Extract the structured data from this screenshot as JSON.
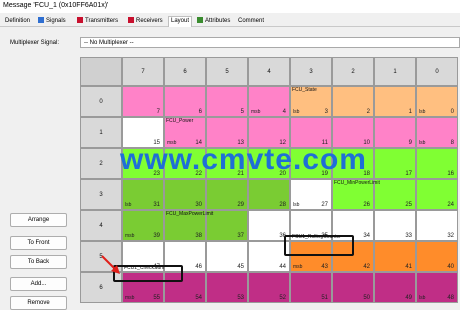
{
  "window": {
    "title": "Message 'FCU_1 (0x10FF6A01x)'"
  },
  "tabs": [
    {
      "label": "Definition",
      "icon": "none"
    },
    {
      "label": "Signals",
      "icon": "signal-icon",
      "color": "#2f6fd1"
    },
    {
      "label": "Transmitters",
      "icon": "transmitter-icon",
      "color": "#c8102e"
    },
    {
      "label": "Receivers",
      "icon": "receiver-icon",
      "color": "#c8102e"
    },
    {
      "label": "Layout",
      "icon": "none",
      "active": true
    },
    {
      "label": "Attributes",
      "icon": "attributes-icon",
      "color": "#3a8c2f"
    },
    {
      "label": "Comment",
      "icon": "none"
    }
  ],
  "mux": {
    "label": "Multiplexer Signal:",
    "value": "-- No Multiplexer --"
  },
  "bit_headers": [
    "7",
    "6",
    "5",
    "4",
    "3",
    "2",
    "1",
    "0"
  ],
  "byte_headers": [
    "0",
    "1",
    "2",
    "3",
    "4",
    "5",
    "6"
  ],
  "buttons": {
    "arrange": "Arrange",
    "to_front": "To Front",
    "to_back": "To Back",
    "add": "Add...",
    "remove": "Remove"
  },
  "colors": {
    "pink": "#ff82c8",
    "orange_light": "#ffbf80",
    "green": "#80ff33",
    "green_dark": "#7acc33",
    "orange": "#ff8c2a",
    "magenta": "#c02e86"
  },
  "signals": {
    "state": "FCU_State",
    "power": "FCU_Power",
    "min_power": "FCU_MinPowerLimit",
    "max_power": "FCU_MaxPowerLimit",
    "rolling": "FCU1_RollingCounter",
    "checksum": "FCU1_CheckSum"
  },
  "tags": {
    "lsb": "lsb",
    "msb": "msb"
  },
  "watermark": "www.cmvte.com",
  "cells": [
    [
      "7",
      "6",
      "5",
      "4",
      "3",
      "2",
      "1",
      "0"
    ],
    [
      "15",
      "14",
      "13",
      "12",
      "11",
      "10",
      "9",
      "8"
    ],
    [
      "23",
      "22",
      "21",
      "20",
      "19",
      "18",
      "17",
      "16"
    ],
    [
      "31",
      "30",
      "29",
      "28",
      "27",
      "26",
      "25",
      "24"
    ],
    [
      "39",
      "38",
      "37",
      "36",
      "35",
      "34",
      "33",
      "32"
    ],
    [
      "47",
      "46",
      "45",
      "44",
      "43",
      "42",
      "41",
      "40"
    ],
    [
      "55",
      "54",
      "53",
      "52",
      "51",
      "50",
      "49",
      "48"
    ]
  ]
}
